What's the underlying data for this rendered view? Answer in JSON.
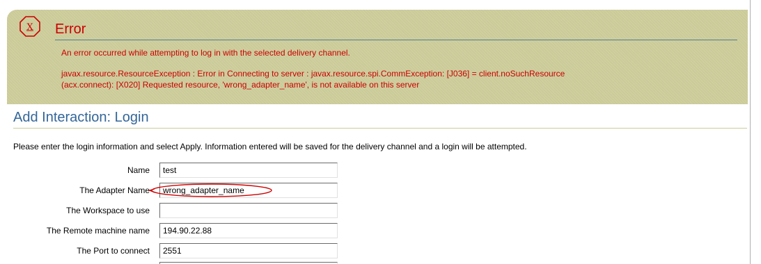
{
  "colors": {
    "error_panel_bg": "#cbcb99",
    "error_text": "#cc0000",
    "heading_text": "#336699",
    "highlight_ellipse": "#cc0000"
  },
  "error": {
    "icon": "error-x-octagon-icon",
    "title": "Error",
    "message": "An error occurred while attempting to log in with the selected delivery channel.",
    "details_line1": "javax.resource.ResourceException : Error in Connecting to server : javax.resource.spi.CommException: [J036] = client.noSuchResource",
    "details_line2": "(acx.connect): [X020] Requested resource, 'wrong_adapter_name', is not available on this server"
  },
  "section": {
    "title": "Add Interaction: Login",
    "instructions": "Please enter the login information and select Apply. Information entered will be saved for the delivery channel and a login will be attempted."
  },
  "form": {
    "fields": [
      {
        "label": "Name",
        "value": "test"
      },
      {
        "label": "The Adapter Name",
        "value": "wrong_adapter_name"
      },
      {
        "label": "The Workspace to use",
        "value": ""
      },
      {
        "label": "The Remote machine name",
        "value": "194.90.22.88"
      },
      {
        "label": "The Port to connect",
        "value": "2551"
      }
    ]
  }
}
